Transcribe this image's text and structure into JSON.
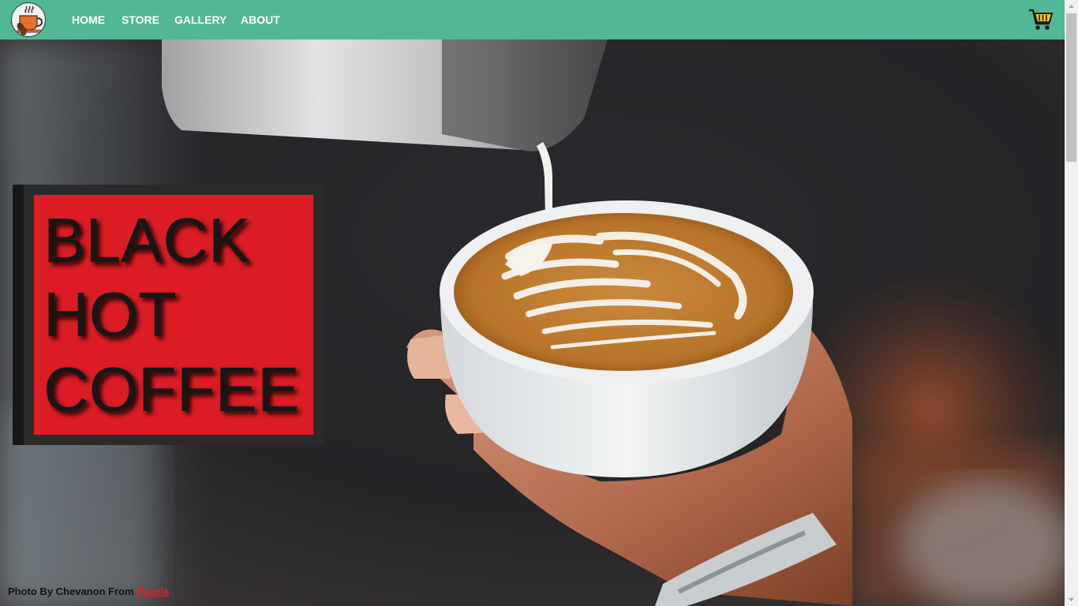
{
  "nav": {
    "logo_icon": "coffee-cup-logo-icon",
    "links": [
      {
        "label": "HOME"
      },
      {
        "label": "STORE"
      },
      {
        "label": "GALLERY"
      },
      {
        "label": "ABOUT"
      }
    ],
    "cart_icon": "shopping-cart-icon"
  },
  "hero": {
    "image": "latte-art-pour-photo",
    "title_lines": [
      "BLACK",
      "HOT",
      "COFFEE"
    ]
  },
  "credit": {
    "text": "Photo By Chevanon From",
    "source": "Pexels"
  },
  "colors": {
    "navbar": "#52b797",
    "title_red": "#db1c24",
    "title_text": "#161616",
    "credit_link": "#e02025"
  }
}
